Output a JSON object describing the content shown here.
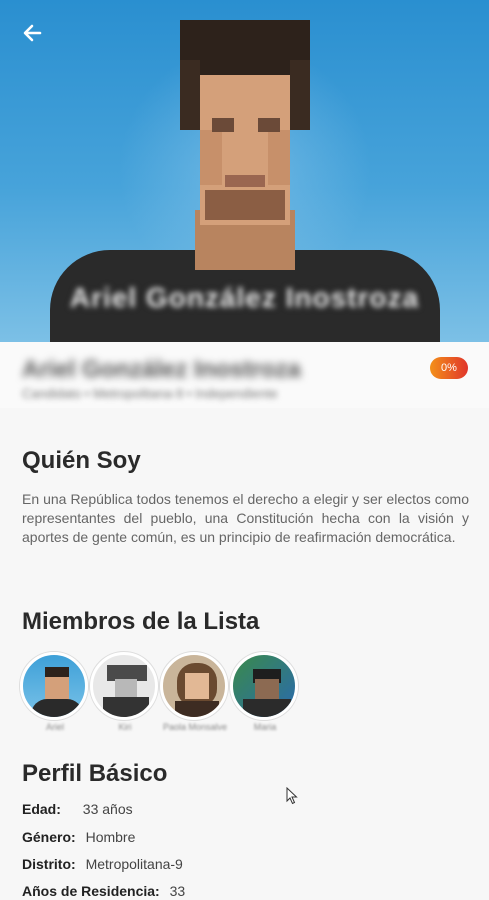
{
  "header": {
    "back_icon": "arrow-left-icon",
    "photo_overlay_name": "Ariel González Inostroza",
    "candidate_name": "Ariel González Inostroza",
    "candidate_subtitle": "Candidato • Metropolitana-9 • Independiente",
    "badge": "0%",
    "badge_colors": [
      "#f39019",
      "#e0352b"
    ]
  },
  "about": {
    "title": "Quién Soy",
    "text": "En una República todos tenemos el derecho a elegir y ser electos como representantes del pueblo, una Constitución hecha con la visión y aportes de gente común, es un principio de reafirmación democrática."
  },
  "members": {
    "title": "Miembros de la Lista",
    "items": [
      {
        "name": "Ariel"
      },
      {
        "name": "Kiri"
      },
      {
        "name": "Paola Monsalve"
      },
      {
        "name": "Maria"
      }
    ]
  },
  "profile": {
    "title": "Perfil Básico",
    "rows": [
      {
        "label": "Edad:",
        "value": "33 años"
      },
      {
        "label": "Género:",
        "value": "Hombre"
      },
      {
        "label": "Distrito:",
        "value": "Metropolitana-9"
      },
      {
        "label": "Años de Residencia:",
        "value": "33"
      }
    ]
  }
}
